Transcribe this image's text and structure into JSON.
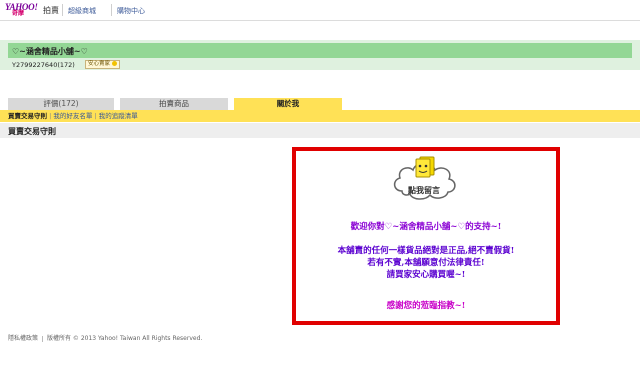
{
  "header": {
    "logo_line1": "YAHOO!",
    "logo_line2": "奇摩",
    "auction_label": "拍賣",
    "links": [
      "超級商城",
      "購物中心"
    ]
  },
  "store": {
    "name": "♡~涵舍精品小舖~♡",
    "seller_id": "Y2799227640(172)",
    "badge": "安心賣家"
  },
  "tabs": [
    {
      "label": "評價(172)"
    },
    {
      "label": "拍賣商品"
    },
    {
      "label": "關於我"
    }
  ],
  "subnav": {
    "items": [
      "買賣交易守則",
      "我的好友名單",
      "我的追蹤清單"
    ]
  },
  "section": {
    "title": "買賣交易守則"
  },
  "message_box": {
    "cloud_label": "點我留言",
    "lines": [
      "歡迎你對♡~涵舍精品小舖~♡的支持~!",
      "本舖賣的任何一樣貨品絕對是正品,絕不賣假貨!",
      "若有不實,本舖願意付法律責任!",
      "請買家安心購買喔~!",
      "感謝您的蒞臨指教~!"
    ]
  },
  "footer": {
    "privacy": "隱私權政策",
    "copyright": "版權所有 © 2013 Yahoo! Taiwan All Rights Reserved."
  },
  "colors": {
    "store_bar": "#93d795",
    "store_band": "#dff1df",
    "active_tab": "#ffe156",
    "inactive_tab": "#d9d9d9",
    "box_border": "#e00000",
    "text_purple": "#8a00d4",
    "text_magenta": "#c800c8"
  }
}
